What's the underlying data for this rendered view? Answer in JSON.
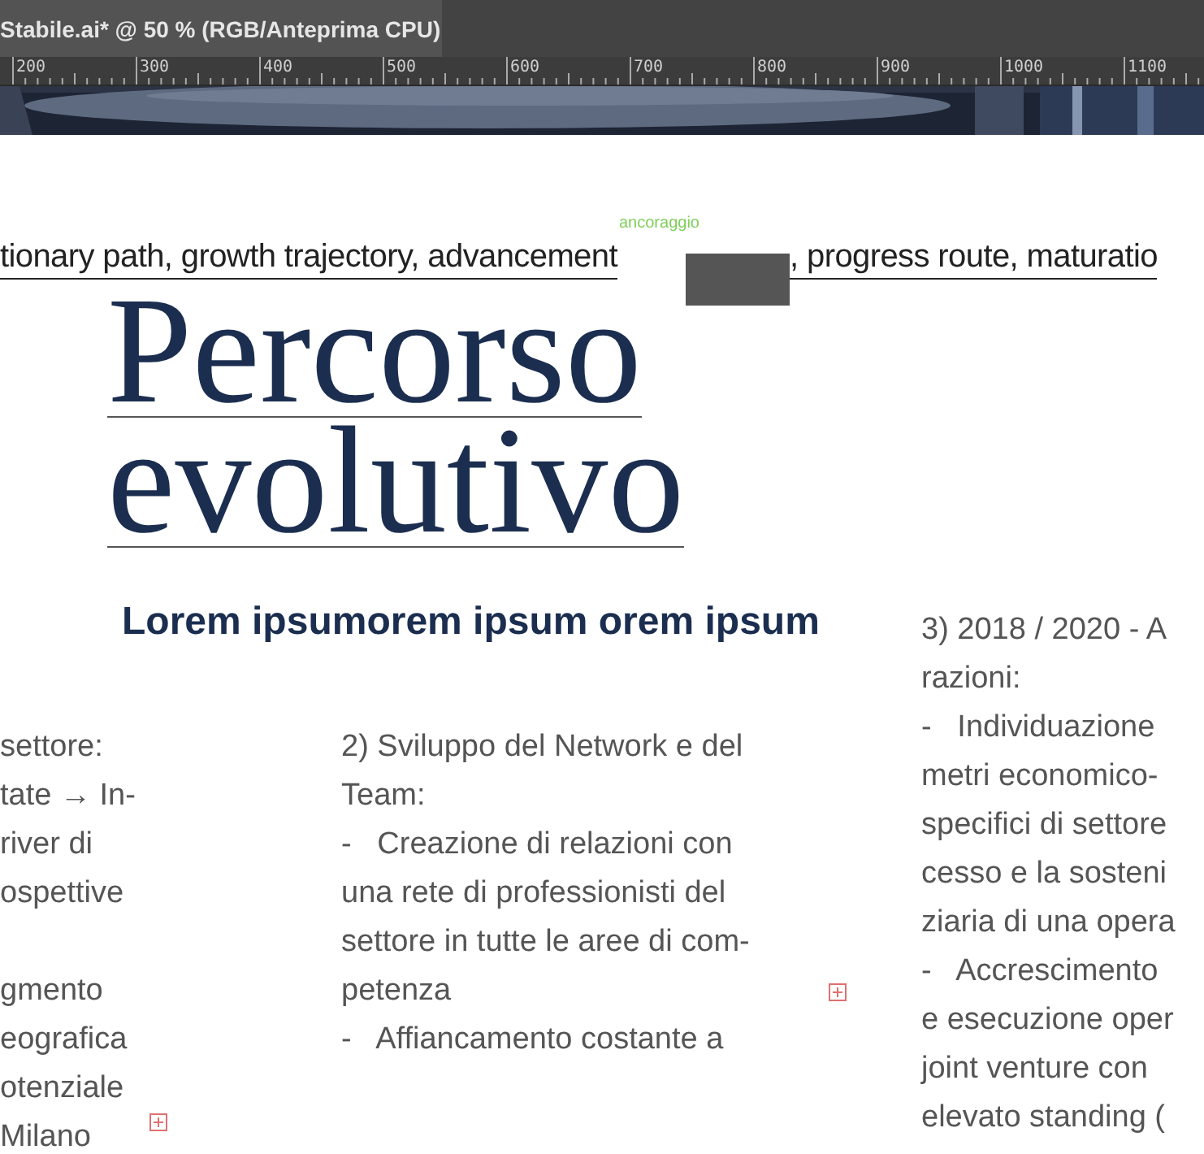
{
  "document_tab": {
    "title": "Stabile.ai* @ 50 % (RGB/Anteprima CPU)",
    "selected": true
  },
  "ruler": {
    "labels": [
      "200",
      "300",
      "400",
      "500",
      "600",
      "700",
      "800",
      "900",
      "1000",
      "1100"
    ]
  },
  "tagline": {
    "left": "tionary path, growth trajectory, advancement",
    "right": ", progress route, maturatio",
    "anchor_label": "ancoraggio"
  },
  "title": {
    "lines": [
      "Percorso",
      "evolutivo"
    ]
  },
  "subtitle": "Lorem ipsumorem ipsum orem ipsum",
  "columns": [
    {
      "lines": [
        "settore:",
        "tate → In-",
        "river di",
        "ospettive"
      ],
      "lines_after_gap": [
        "gmento",
        "eografica",
        "otenziale",
        "Milano"
      ],
      "overset": true
    },
    {
      "lines": [
        "2) Sviluppo del Network e del",
        "Team:",
        "-   Creazione di relazioni con",
        "una rete di professionisti del",
        "settore in tutte le aree di com-",
        "petenza",
        "-   Affiancamento costante a"
      ],
      "overset": true
    },
    {
      "lines": [
        "3) 2018 / 2020 - A",
        "razioni:",
        "-   Individuazione",
        "metri economico-",
        "specifici di settore",
        "cesso e la sosteni",
        "ziaria di una opera",
        "-   Accrescimento",
        "e esecuzione oper",
        "joint venture con",
        "elevato standing ("
      ],
      "overset": false
    }
  ]
}
